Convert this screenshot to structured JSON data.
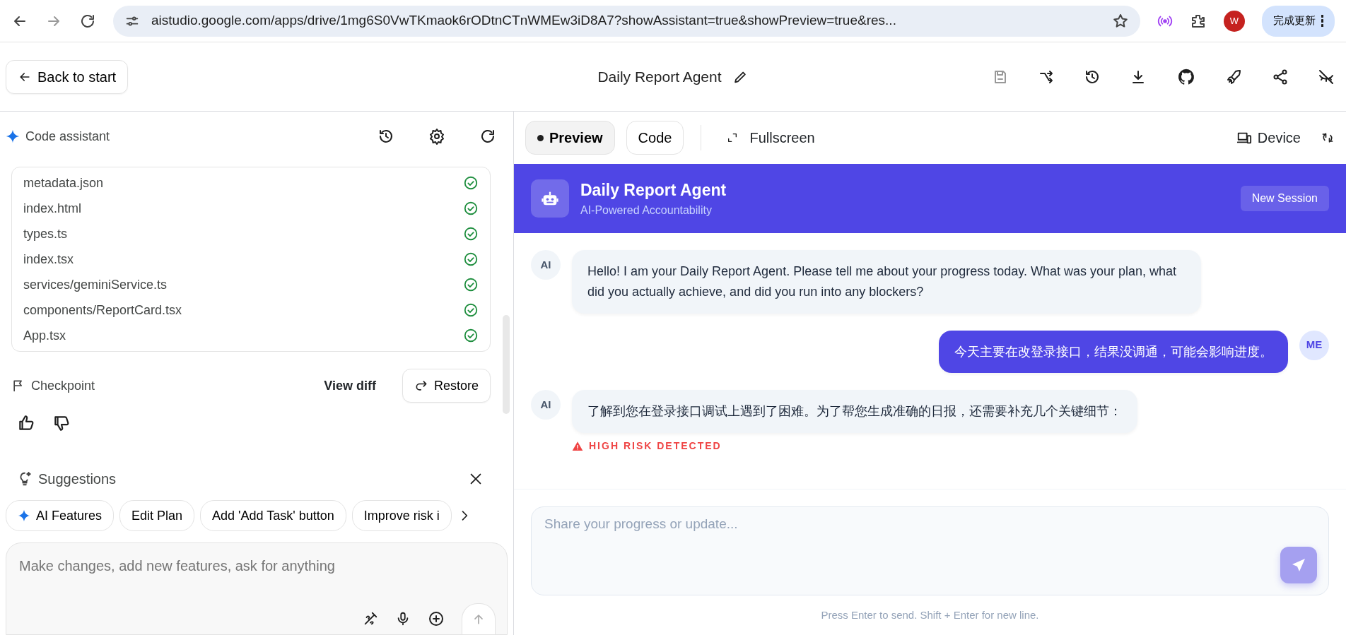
{
  "browser": {
    "url": "aistudio.google.com/apps/drive/1mg6S0VwTKmaok6rODtnCTnWMEw3iD8A7?showAssistant=true&showPreview=true&res...",
    "avatar": "W",
    "update_button": "完成更新"
  },
  "header": {
    "back_button": "Back to start",
    "title": "Daily Report Agent"
  },
  "assistant": {
    "title": "Code assistant",
    "files": [
      {
        "name": "metadata.json",
        "done": true
      },
      {
        "name": "index.html",
        "done": true
      },
      {
        "name": "types.ts",
        "done": true
      },
      {
        "name": "index.tsx",
        "done": true
      },
      {
        "name": "services/geminiService.ts",
        "done": true
      },
      {
        "name": "components/ReportCard.tsx",
        "done": true
      },
      {
        "name": "App.tsx",
        "done": true
      }
    ],
    "checkpoint": {
      "label": "Checkpoint",
      "view_diff": "View diff",
      "restore": "Restore"
    },
    "suggestions": {
      "title": "Suggestions",
      "chips": [
        {
          "label": "AI Features",
          "kind": "sparkle"
        },
        {
          "label": "Edit Plan",
          "kind": "plain"
        },
        {
          "label": "Add 'Add Task' button",
          "kind": "plain"
        },
        {
          "label": "Improve risk i",
          "kind": "plain"
        }
      ]
    },
    "prompt": {
      "placeholder": "Make changes, add new features, ask for anything"
    }
  },
  "preview": {
    "tabs": [
      {
        "label": "Preview",
        "selected": true
      },
      {
        "label": "Code",
        "selected": false
      }
    ],
    "fullscreen": "Fullscreen",
    "device": "Device",
    "app": {
      "title": "Daily Report Agent",
      "subtitle": "AI-Powered Accountability",
      "new_session": "New Session",
      "messages": [
        {
          "kind": "ai",
          "avatar": "AI",
          "text": "Hello! I am your Daily Report Agent. Please tell me about your progress today. What was your plan, what did you actually achieve, and did you run into any blockers?"
        },
        {
          "kind": "user",
          "avatar": "ME",
          "text": "今天主要在改登录接口，结果没调通，可能会影响进度。"
        },
        {
          "kind": "ai",
          "avatar": "AI",
          "text": "了解到您在登录接口调试上遇到了困难。为了帮您生成准确的日报，还需要补充几个关键细节：",
          "alert": "HIGH RISK DETECTED"
        }
      ],
      "input": {
        "placeholder": "Share your progress or update..."
      },
      "hint": "Press Enter to send. Shift + Enter for new line."
    }
  }
}
